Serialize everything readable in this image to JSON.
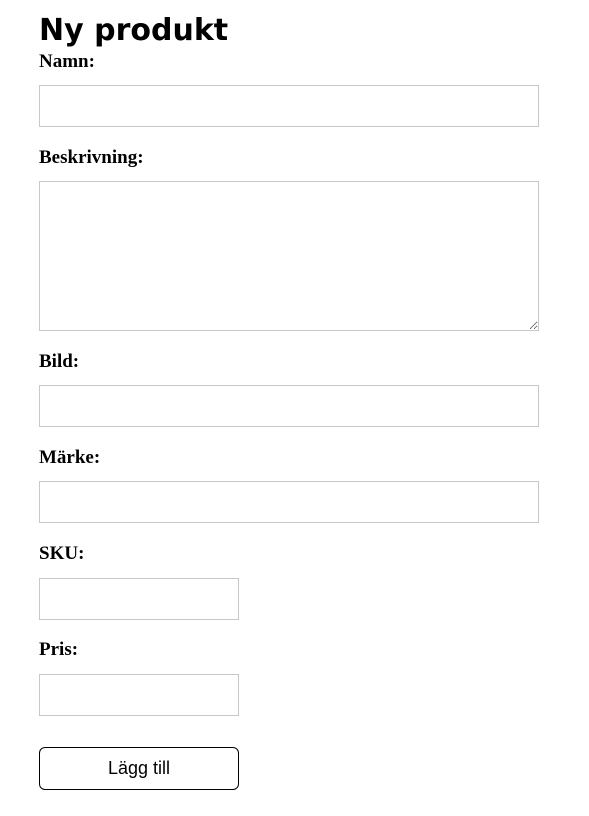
{
  "form": {
    "title": "Ny produkt",
    "fields": {
      "name": {
        "label": "Namn:",
        "value": ""
      },
      "description": {
        "label": "Beskrivning:",
        "value": ""
      },
      "image": {
        "label": "Bild:",
        "value": ""
      },
      "brand": {
        "label": "Märke:",
        "value": ""
      },
      "sku": {
        "label": "SKU:",
        "value": ""
      },
      "price": {
        "label": "Pris:",
        "value": ""
      }
    },
    "submit_label": "Lägg till"
  }
}
